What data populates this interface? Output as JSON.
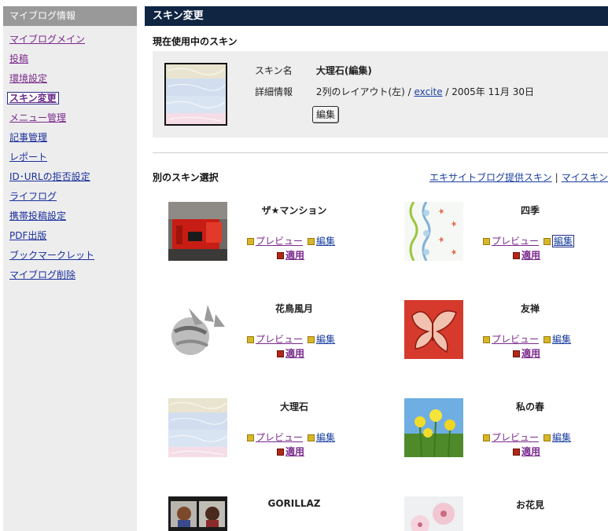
{
  "sidebar": {
    "header": "マイブログ情報",
    "items": [
      {
        "label": "マイブログメイン"
      },
      {
        "label": "投稿"
      },
      {
        "label": "環境設定"
      },
      {
        "label": "スキン変更"
      },
      {
        "label": "メニュー管理"
      },
      {
        "label": "記事管理"
      },
      {
        "label": "レポート"
      },
      {
        "label": "ID･URLの拒否設定"
      },
      {
        "label": "ライフログ"
      },
      {
        "label": "携帯投稿設定"
      },
      {
        "label": "PDF出版"
      },
      {
        "label": "ブックマークレット"
      },
      {
        "label": "マイブログ削除"
      }
    ]
  },
  "main": {
    "header": "スキン変更",
    "current": {
      "title": "現在使用中のスキン",
      "name_label": "スキン名",
      "name_value": "大理石(編集)",
      "detail_label": "詳細情報",
      "detail_prefix": "2列のレイアウト(左) / ",
      "detail_link": "excite",
      "detail_suffix": " / 2005年 11月 30日",
      "edit_button": "編集"
    },
    "other": {
      "title": "別のスキン選択",
      "link_excite": "エキサイトブログ提供スキン",
      "separator": "|",
      "link_my": "マイスキン"
    },
    "action_labels": {
      "preview": "プレビュー",
      "edit": "編集",
      "apply": "適用"
    },
    "skins": [
      {
        "name": "ザ★マンション"
      },
      {
        "name": "四季"
      },
      {
        "name": "花鳥風月"
      },
      {
        "name": "友禅"
      },
      {
        "name": "大理石"
      },
      {
        "name": "私の春"
      },
      {
        "name": "GORILLAZ"
      },
      {
        "name": "お花見"
      }
    ]
  }
}
